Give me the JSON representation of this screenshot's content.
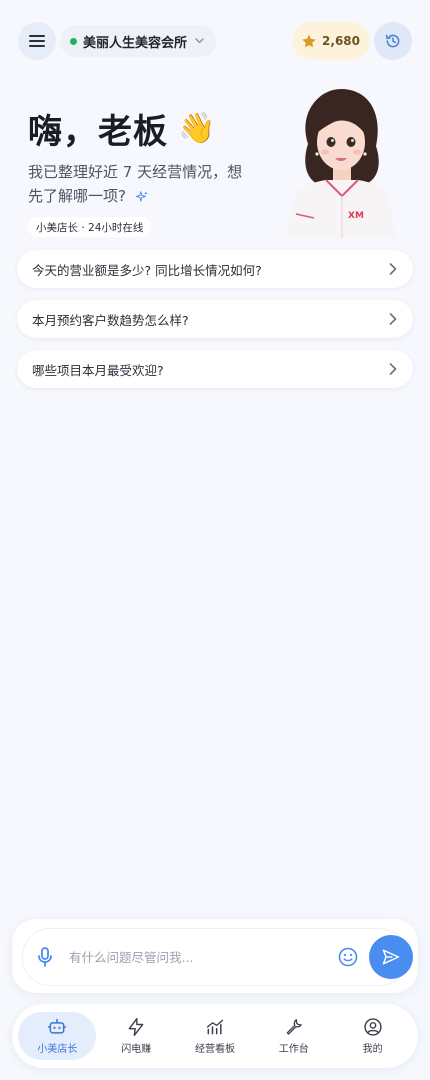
{
  "header": {
    "store_name": "美丽人生美容会所",
    "points": "2,680"
  },
  "hero": {
    "greeting": "嗨，老板",
    "wave_emoji": "👋",
    "subtitle": "我已整理好近 7 天经营情况，想先了解哪一项?",
    "online_badge": "小美店长 · 24小时在线",
    "avatar_logo": "XM"
  },
  "questions": [
    {
      "label": "今天的营业额是多少? 同比增长情况如何?"
    },
    {
      "label": "本月预约客户数趋势怎么样?"
    },
    {
      "label": "哪些项目本月最受欢迎?"
    }
  ],
  "input": {
    "placeholder": "有什么问题尽管问我..."
  },
  "tabs": [
    {
      "label": "小美店长",
      "icon": "robot-icon",
      "active": true
    },
    {
      "label": "闪电赚",
      "icon": "lightning-icon"
    },
    {
      "label": "经营看板",
      "icon": "chart-icon"
    },
    {
      "label": "工作台",
      "icon": "wrench-icon"
    },
    {
      "label": "我的",
      "icon": "user-icon"
    }
  ],
  "colors": {
    "accent": "#4a8df0",
    "online": "#22b35e",
    "points_bg": "#fdf3dd",
    "star": "#d99a1f"
  }
}
